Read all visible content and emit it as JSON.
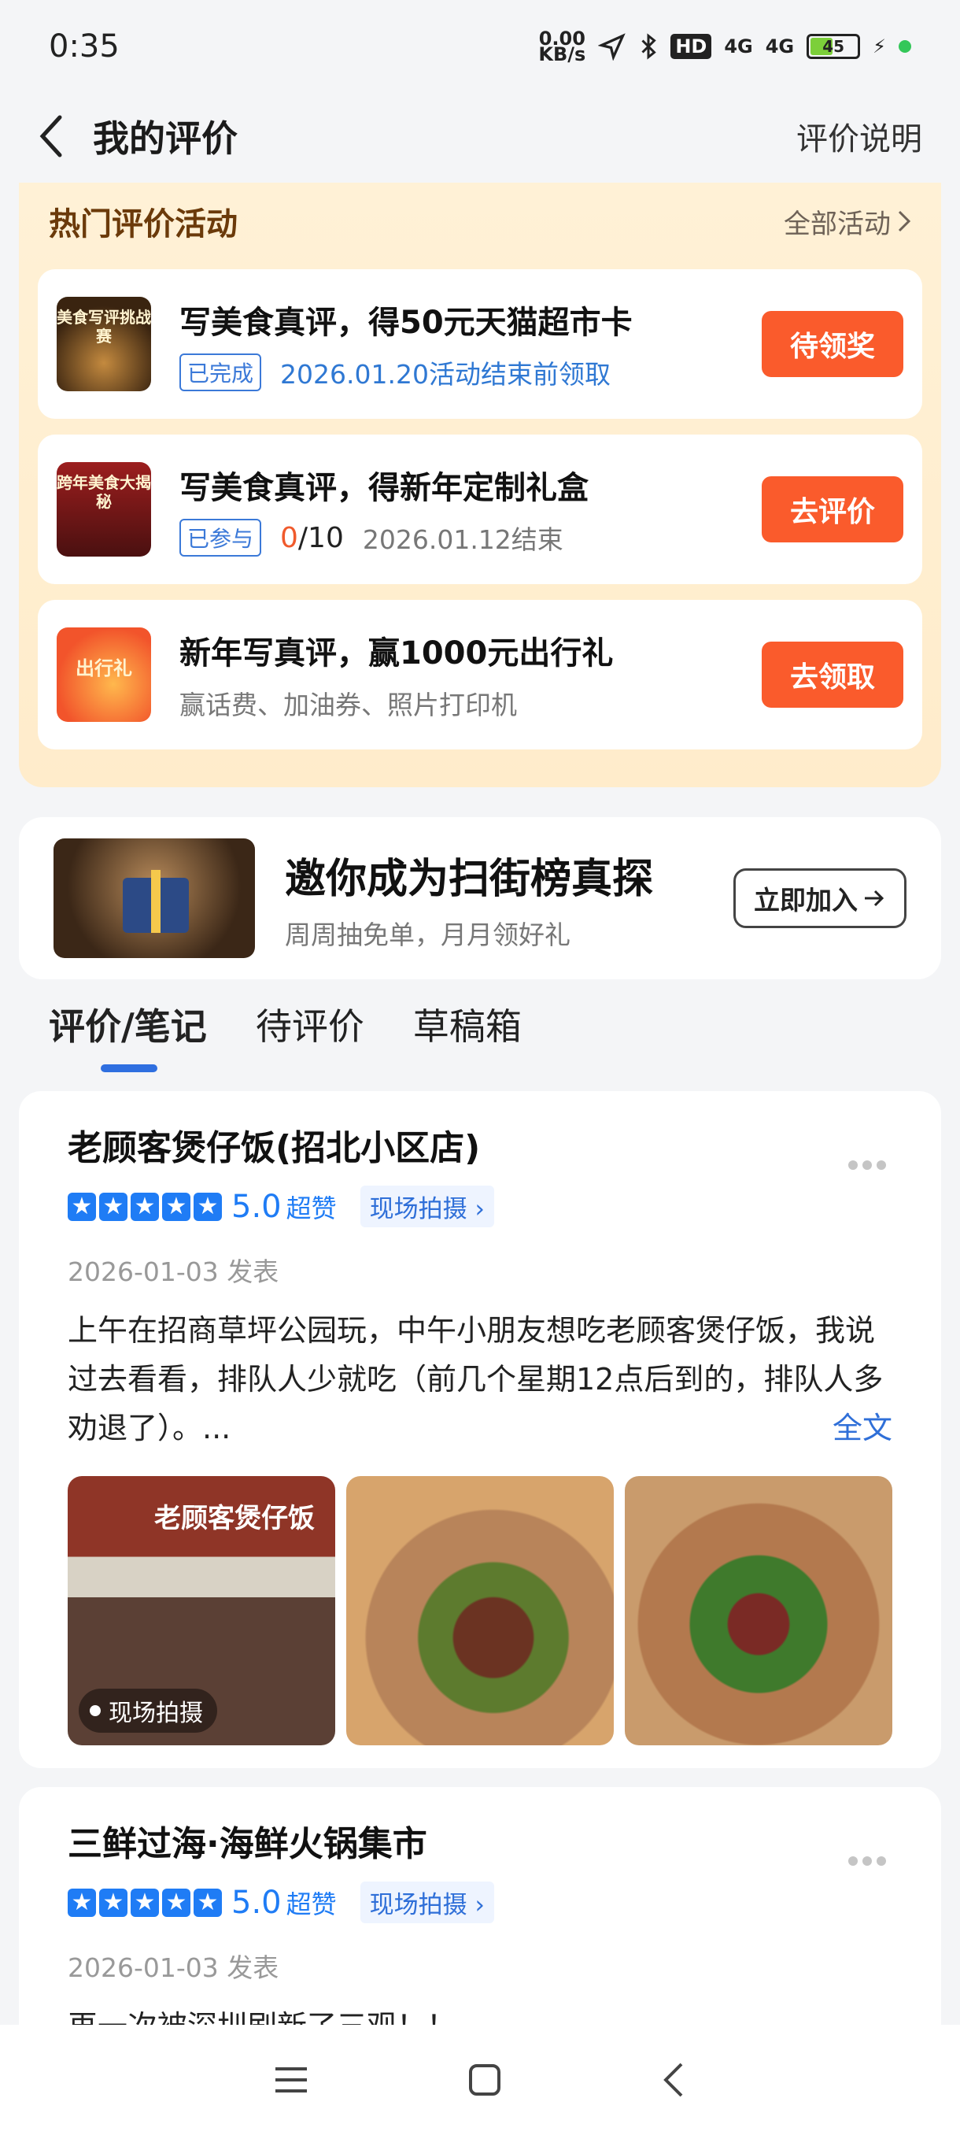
{
  "status_bar": {
    "time": "0:35",
    "net_speed_top": "0.00",
    "net_speed_bottom": "KB/s",
    "hd_label": "HD",
    "signal1": "4G",
    "signal2": "4G",
    "battery_level": "45",
    "battery_fraction": 0.45
  },
  "header": {
    "title": "我的评价",
    "help_link": "评价说明"
  },
  "activities": {
    "title": "热门评价活动",
    "all_link": "全部活动",
    "items": [
      {
        "thumb_text": "美食写评挑战赛",
        "title": "写美食真评，得50元天猫超市卡",
        "tag": "已完成",
        "subtitle": "2026.01.20活动结束前领取",
        "button": "待领奖"
      },
      {
        "thumb_text": "跨年美食大揭秘",
        "title": "写美食真评，得新年定制礼盒",
        "tag": "已参与",
        "progress_done": "0",
        "progress_total": "/10",
        "subtitle": "2026.01.12结束",
        "button": "去评价"
      },
      {
        "thumb_text": "出行礼",
        "title": "新年写真评，赢1000元出行礼",
        "subtitle": "赢话费、加油券、照片打印机",
        "button": "去领取"
      }
    ]
  },
  "invite": {
    "title": "邀你成为扫街榜真探",
    "subtitle": "周周抽免单，月月领好礼",
    "button": "立即加入"
  },
  "tabs": [
    {
      "label": "评价/笔记",
      "active": true
    },
    {
      "label": "待评价",
      "active": false
    },
    {
      "label": "草稿箱",
      "active": false
    }
  ],
  "reviews": [
    {
      "name": "老顾客煲仔饭(招北小区店)",
      "score": "5.0",
      "score_label": "超赞",
      "scene_tag": "现场拍摄",
      "date": "2026-01-03 发表",
      "text": "上午在招商草坪公园玩，中午小朋友想吃老顾客煲仔饭，我说过去看看，排队人少就吃（前几个星期12点后到的，排队人多劝退了）。...",
      "fulltext_link": "全文",
      "photo_sign": "老顾客煲仔饭",
      "photo_badge": "现场拍摄"
    },
    {
      "name": "三鲜过海·海鲜火锅集市",
      "score": "5.0",
      "score_label": "超赞",
      "scene_tag": "现场拍摄",
      "date": "2026-01-03 发表",
      "text": "再一次被深圳刷新了三观！！"
    }
  ],
  "colors": {
    "accent_blue": "#1f7cf5",
    "action_orange": "#fa5b2c",
    "panel_cream": "#fff1d6"
  }
}
